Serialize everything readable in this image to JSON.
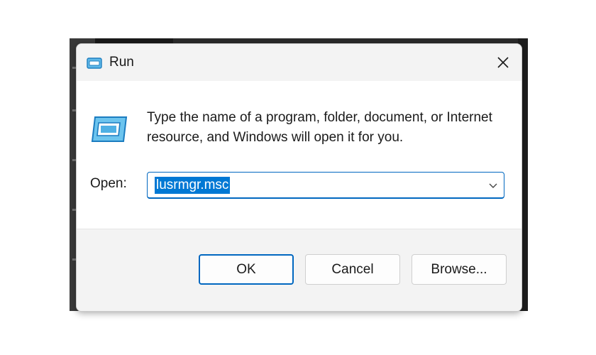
{
  "window": {
    "title": "Run",
    "icon": "run-app-icon",
    "close_icon": "close-icon"
  },
  "content": {
    "description": "Type the name of a program, folder, document, or Internet resource, and Windows will open it for you.",
    "open_label": "Open:",
    "open_value": "lusrmgr.msc",
    "dropdown_icon": "chevron-down-icon"
  },
  "buttons": {
    "ok": "OK",
    "cancel": "Cancel",
    "browse": "Browse..."
  },
  "colors": {
    "accent": "#0067c0",
    "selection": "#0078d4",
    "dialog_bg": "#f3f3f3",
    "content_bg": "#ffffff"
  }
}
